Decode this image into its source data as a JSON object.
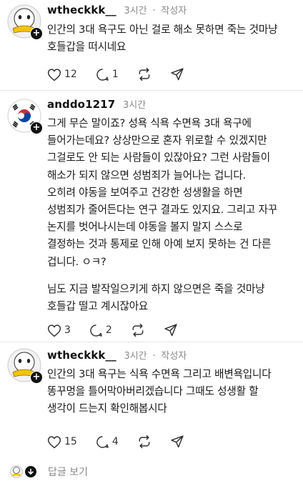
{
  "comments": [
    {
      "user": "wtheckkk__",
      "time": "3시간",
      "separator": "·",
      "author_badge": "작성자",
      "lines": [
        "인간의 3대 욕구도 아닌 걸로 해소 못하면 죽는 것마냥",
        "호들갑을 떠시네요"
      ],
      "likes": "12",
      "replies": "1"
    },
    {
      "user": "anddo1217",
      "time": "3시간",
      "lines": [
        "그게 무슨 말이죠? 성욕 식욕 수면욕 3대 욕구에",
        "들어가는데요? 상상만으로 혼자 위로할 수 있겠지만",
        "그걸로도 안 되는 사람들이 있잖아요? 그런 사람들이",
        "해소가 되지 않으면 성범죄가 늘어나는 겁니다.",
        "오히려 야동을 보여주고 건강한 성생활을 하면",
        "성범죄가 줄어든다는 연구 결과도 있지요. 그리고 자꾸",
        "논지를 벗어나시는데 야동을 볼지 말지 스스로",
        "결정하는 것과 통제로 인해 아예 보지 못하는 건 다른",
        "겁니다. ㅇㅋ?"
      ],
      "lines2": [
        "님도 지금 발작일으키게 하지 않으면은 죽을 것마냥",
        "호들갑 떨고  계시잖아요"
      ],
      "likes": "3",
      "replies": "2"
    },
    {
      "user": "wtheckkk__",
      "time": "3시간",
      "separator": "·",
      "author_badge": "작성자",
      "lines": [
        "인간의 3대 욕구는 식욕 수면욕 그리고 배변욕입니다",
        "똥꾸멍을 틀어막아버리겠습니다 그때도 성생활 할",
        "생각이 드는지 확인해봅시다"
      ],
      "likes": "15",
      "replies": "4"
    }
  ],
  "footer": {
    "view_replies": "답글 보기"
  },
  "colors": {
    "duck_yellow": "#f5c400",
    "flag_red": "#cd2e3a",
    "flag_blue": "#0047a0"
  },
  "icons": [
    "heart-icon",
    "comment-icon",
    "repost-icon",
    "share-icon",
    "plus-icon",
    "chevron-down-icon"
  ]
}
